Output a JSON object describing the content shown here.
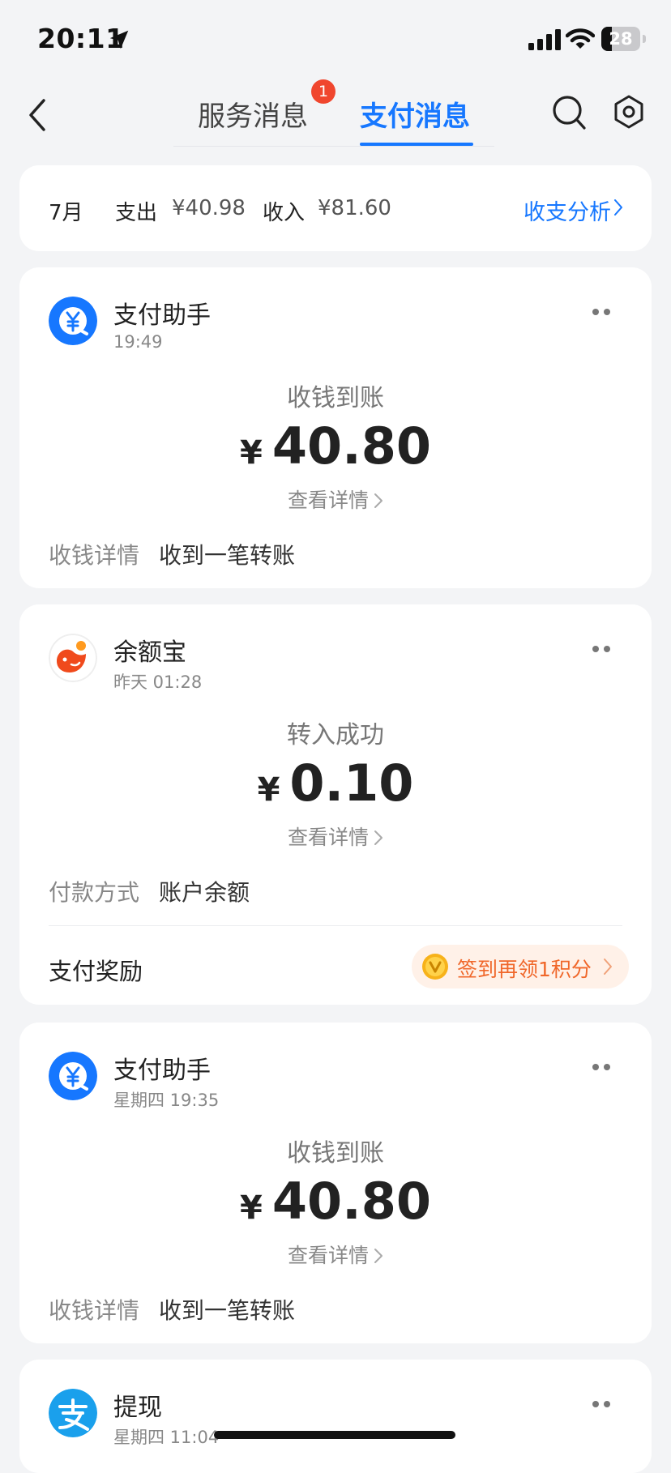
{
  "status_bar": {
    "time": "20:11",
    "battery": "28",
    "battery_level": 0.28
  },
  "nav": {
    "tabs": [
      {
        "label": "服务消息",
        "badge": "1"
      },
      {
        "label": "支付消息"
      }
    ]
  },
  "summary": {
    "month": "7月",
    "expense_label": "支出",
    "expense_value": "¥40.98",
    "income_label": "收入",
    "income_value": "¥81.60",
    "analysis_label": "收支分析"
  },
  "messages": [
    {
      "name": "支付助手",
      "time": "19:49",
      "title": "收钱到账",
      "currency": "¥",
      "amount": "40.80",
      "detail_link": "查看详情",
      "info_label": "收钱详情",
      "info_value": "收到一笔转账"
    },
    {
      "name": "余额宝",
      "time": "昨天 01:28",
      "title": "转入成功",
      "currency": "¥",
      "amount": "0.10",
      "detail_link": "查看详情",
      "info_label": "付款方式",
      "info_value": "账户余额",
      "reward_label": "支付奖励",
      "reward_action": "签到再领1积分"
    },
    {
      "name": "支付助手",
      "time": "星期四 19:35",
      "title": "收钱到账",
      "currency": "¥",
      "amount": "40.80",
      "detail_link": "查看详情",
      "info_label": "收钱详情",
      "info_value": "收到一笔转账"
    },
    {
      "name": "提现",
      "time": "星期四 11:04"
    }
  ],
  "icons": {
    "location": "location-arrow-icon",
    "signal": "signal-bars-icon",
    "wifi": "wifi-icon",
    "back": "chevron-left-icon",
    "search": "search-icon",
    "settings": "gear-icon",
    "more": "more-dots-icon",
    "pay_assistant": "yuan-coin-icon",
    "yuebao": "yuebao-icon",
    "alipay": "alipay-icon"
  },
  "colors": {
    "accent": "#1677ff",
    "badge": "#f0462e",
    "reward": "#f0672a",
    "yuebao": "#f04a1c"
  }
}
